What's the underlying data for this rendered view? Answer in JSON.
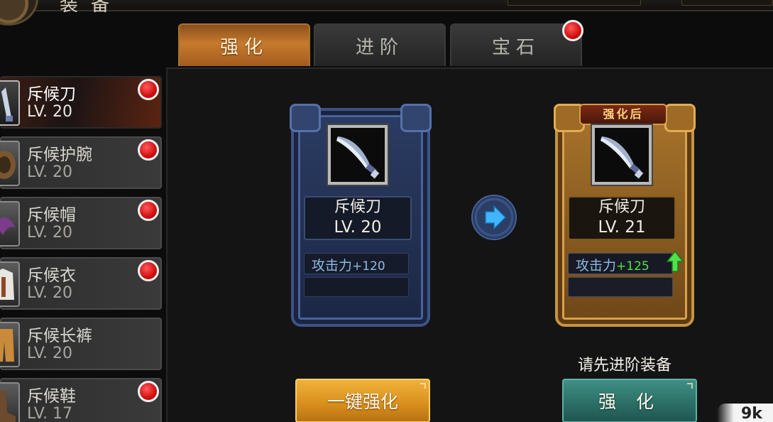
{
  "header": {
    "title": "装备"
  },
  "tabs": [
    {
      "label": "强化",
      "active": true,
      "badge": false
    },
    {
      "label": "进阶",
      "active": false,
      "badge": false
    },
    {
      "label": "宝石",
      "active": false,
      "badge": true
    }
  ],
  "equipment": [
    {
      "name": "斥候刀",
      "level": "LV. 20",
      "selected": true,
      "badge": true
    },
    {
      "name": "斥候护腕",
      "level": "LV. 20",
      "selected": false,
      "badge": true
    },
    {
      "name": "斥候帽",
      "level": "LV. 20",
      "selected": false,
      "badge": true
    },
    {
      "name": "斥候衣",
      "level": "LV. 20",
      "selected": false,
      "badge": true
    },
    {
      "name": "斥候长裤",
      "level": "LV. 20",
      "selected": false,
      "badge": false
    },
    {
      "name": "斥候鞋",
      "level": "LV. 17",
      "selected": false,
      "badge": true
    }
  ],
  "current": {
    "name": "斥候刀",
    "level": "LV. 20",
    "stat_label": "攻击力",
    "stat_value": "+120"
  },
  "after": {
    "banner": "强化后",
    "name": "斥候刀",
    "level": "LV. 21",
    "stat_label": "攻击力",
    "stat_value": "+125"
  },
  "hint": "请先进阶装备",
  "buttons": {
    "one_click": "一键强化",
    "enhance": "强 化"
  },
  "watermark": "9k",
  "colors": {
    "accent_gold": "#d88e1c",
    "accent_green": "#2b6d64",
    "badge_red": "#d10f0f",
    "stat_up": "#4fe24a"
  }
}
